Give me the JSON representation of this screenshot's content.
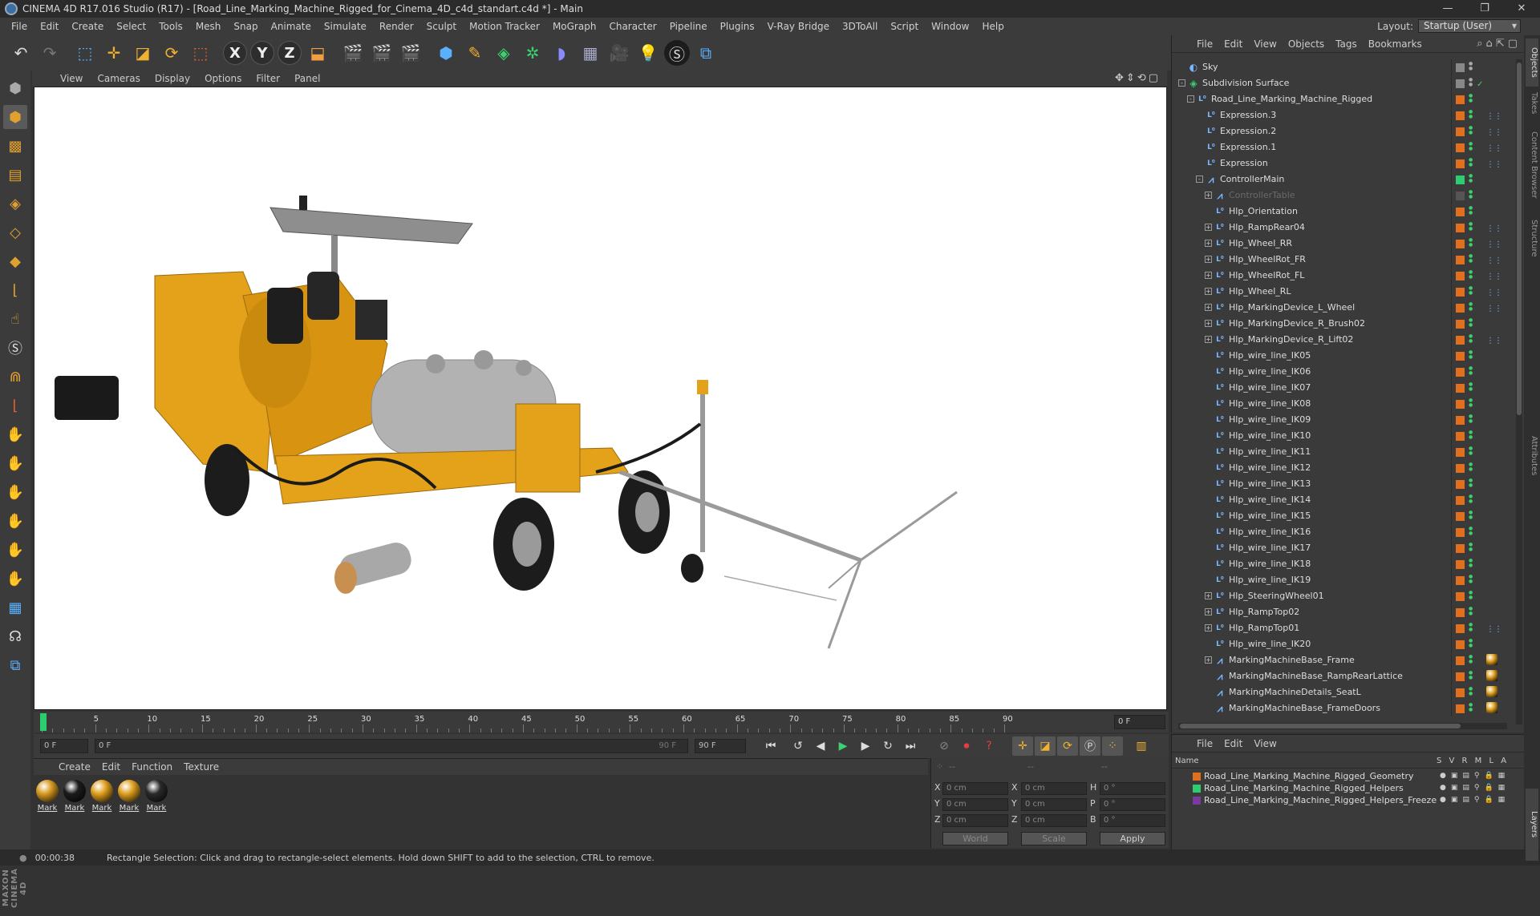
{
  "window": {
    "title": "CINEMA 4D R17.016 Studio (R17) - [Road_Line_Marking_Machine_Rigged_for_Cinema_4D_c4d_standart.c4d *] - Main",
    "layout_label": "Layout:",
    "layout_value": "Startup (User)"
  },
  "menu": [
    "File",
    "Edit",
    "Create",
    "Select",
    "Tools",
    "Mesh",
    "Snap",
    "Animate",
    "Simulate",
    "Render",
    "Sculpt",
    "Motion Tracker",
    "MoGraph",
    "Character",
    "Pipeline",
    "Plugins",
    "V-Ray Bridge",
    "3DToAll",
    "Script",
    "Window",
    "Help"
  ],
  "toolbar": {
    "x": "X",
    "y": "Y",
    "z": "Z"
  },
  "viewport_menu": [
    "View",
    "Cameras",
    "Display",
    "Options",
    "Filter",
    "Panel"
  ],
  "timeline": {
    "ticks": [
      "0",
      "5",
      "10",
      "15",
      "20",
      "25",
      "30",
      "35",
      "40",
      "45",
      "50",
      "55",
      "60",
      "65",
      "70",
      "75",
      "80",
      "85",
      "90"
    ],
    "current_field": "0 F"
  },
  "playback": {
    "start": "0 F",
    "range_start": "0 F",
    "range_end": "90 F",
    "end": "90 F"
  },
  "material_menu": [
    "Create",
    "Edit",
    "Function",
    "Texture"
  ],
  "materials": [
    {
      "label": "Mark",
      "color": "#d89a20"
    },
    {
      "label": "Mark",
      "color": "#1c1c1c"
    },
    {
      "label": "Mark",
      "color": "#e0a020"
    },
    {
      "label": "Mark",
      "color": "#e0a020"
    },
    {
      "label": "Mark",
      "color": "#2a2a2a"
    }
  ],
  "coords": {
    "header": [
      "--",
      "--",
      "--"
    ],
    "x": "X",
    "y": "Y",
    "z": "Z",
    "h": "H",
    "p": "P",
    "b": "B",
    "x_pos": "0 cm",
    "y_pos": "0 cm",
    "z_pos": "0 cm",
    "x_size": "0 cm",
    "y_size": "0 cm",
    "z_size": "0 cm",
    "h_val": "0 °",
    "p_val": "0 °",
    "b_val": "0 °",
    "world": "World",
    "scale": "Scale",
    "apply": "Apply"
  },
  "status": {
    "time": "00:00:38",
    "message": "Rectangle Selection: Click and drag to rectangle-select elements. Hold down SHIFT to add to the selection, CTRL to remove."
  },
  "object_menu": [
    "File",
    "Edit",
    "View",
    "Objects",
    "Tags",
    "Bookmarks"
  ],
  "objects": [
    {
      "name": "Sky",
      "indent": 0,
      "icon": "sky",
      "tag": "#888",
      "ex": ""
    },
    {
      "name": "Subdivision Surface",
      "indent": 0,
      "icon": "sub",
      "tag": "#888",
      "ex": "-",
      "check": "✓"
    },
    {
      "name": "Road_Line_Marking_Machine_Rigged",
      "indent": 1,
      "icon": "null",
      "tag": "#e07020",
      "ex": "-"
    },
    {
      "name": "Expression.3",
      "indent": 2,
      "icon": "null",
      "tag": "#e07020",
      "ex": "",
      "xp": "⋮⋮"
    },
    {
      "name": "Expression.2",
      "indent": 2,
      "icon": "null",
      "tag": "#e07020",
      "ex": "",
      "xp": "⋮⋮"
    },
    {
      "name": "Expression.1",
      "indent": 2,
      "icon": "null",
      "tag": "#e07020",
      "ex": "",
      "xp": "⋮⋮"
    },
    {
      "name": "Expression",
      "indent": 2,
      "icon": "null",
      "tag": "#e07020",
      "ex": "",
      "xp": "⋮⋮"
    },
    {
      "name": "ControllerMain",
      "indent": 2,
      "icon": "joint",
      "tag": "#2ecc71",
      "ex": "-"
    },
    {
      "name": "ControllerTable",
      "indent": 3,
      "icon": "joint",
      "tag": "#555",
      "ex": "+",
      "dim": true
    },
    {
      "name": "Hlp_Orientation",
      "indent": 3,
      "icon": "null",
      "tag": "#e07020",
      "ex": ""
    },
    {
      "name": "Hlp_RampRear04",
      "indent": 3,
      "icon": "null",
      "tag": "#e07020",
      "ex": "+",
      "xp": "⋮⋮"
    },
    {
      "name": "Hlp_Wheel_RR",
      "indent": 3,
      "icon": "null",
      "tag": "#e07020",
      "ex": "+",
      "xp": "⋮⋮"
    },
    {
      "name": "Hlp_WheelRot_FR",
      "indent": 3,
      "icon": "null",
      "tag": "#e07020",
      "ex": "+",
      "xp": "⋮⋮"
    },
    {
      "name": "Hlp_WheelRot_FL",
      "indent": 3,
      "icon": "null",
      "tag": "#e07020",
      "ex": "+",
      "xp": "⋮⋮"
    },
    {
      "name": "Hlp_Wheel_RL",
      "indent": 3,
      "icon": "null",
      "tag": "#e07020",
      "ex": "+",
      "xp": "⋮⋮"
    },
    {
      "name": "Hlp_MarkingDevice_L_Wheel",
      "indent": 3,
      "icon": "null",
      "tag": "#e07020",
      "ex": "+",
      "xp": "⋮⋮"
    },
    {
      "name": "Hlp_MarkingDevice_R_Brush02",
      "indent": 3,
      "icon": "null",
      "tag": "#e07020",
      "ex": "+"
    },
    {
      "name": "Hlp_MarkingDevice_R_Lift02",
      "indent": 3,
      "icon": "null",
      "tag": "#e07020",
      "ex": "+",
      "xp": "⋮⋮"
    },
    {
      "name": "Hlp_wire_line_IK05",
      "indent": 3,
      "icon": "null",
      "tag": "#e07020",
      "ex": ""
    },
    {
      "name": "Hlp_wire_line_IK06",
      "indent": 3,
      "icon": "null",
      "tag": "#e07020",
      "ex": ""
    },
    {
      "name": "Hlp_wire_line_IK07",
      "indent": 3,
      "icon": "null",
      "tag": "#e07020",
      "ex": ""
    },
    {
      "name": "Hlp_wire_line_IK08",
      "indent": 3,
      "icon": "null",
      "tag": "#e07020",
      "ex": ""
    },
    {
      "name": "Hlp_wire_line_IK09",
      "indent": 3,
      "icon": "null",
      "tag": "#e07020",
      "ex": ""
    },
    {
      "name": "Hlp_wire_line_IK10",
      "indent": 3,
      "icon": "null",
      "tag": "#e07020",
      "ex": ""
    },
    {
      "name": "Hlp_wire_line_IK11",
      "indent": 3,
      "icon": "null",
      "tag": "#e07020",
      "ex": ""
    },
    {
      "name": "Hlp_wire_line_IK12",
      "indent": 3,
      "icon": "null",
      "tag": "#e07020",
      "ex": ""
    },
    {
      "name": "Hlp_wire_line_IK13",
      "indent": 3,
      "icon": "null",
      "tag": "#e07020",
      "ex": ""
    },
    {
      "name": "Hlp_wire_line_IK14",
      "indent": 3,
      "icon": "null",
      "tag": "#e07020",
      "ex": ""
    },
    {
      "name": "Hlp_wire_line_IK15",
      "indent": 3,
      "icon": "null",
      "tag": "#e07020",
      "ex": ""
    },
    {
      "name": "Hlp_wire_line_IK16",
      "indent": 3,
      "icon": "null",
      "tag": "#e07020",
      "ex": ""
    },
    {
      "name": "Hlp_wire_line_IK17",
      "indent": 3,
      "icon": "null",
      "tag": "#e07020",
      "ex": ""
    },
    {
      "name": "Hlp_wire_line_IK18",
      "indent": 3,
      "icon": "null",
      "tag": "#e07020",
      "ex": ""
    },
    {
      "name": "Hlp_wire_line_IK19",
      "indent": 3,
      "icon": "null",
      "tag": "#e07020",
      "ex": ""
    },
    {
      "name": "Hlp_SteeringWheel01",
      "indent": 3,
      "icon": "null",
      "tag": "#e07020",
      "ex": "+"
    },
    {
      "name": "Hlp_RampTop02",
      "indent": 3,
      "icon": "null",
      "tag": "#e07020",
      "ex": "+"
    },
    {
      "name": "Hlp_RampTop01",
      "indent": 3,
      "icon": "null",
      "tag": "#e07020",
      "ex": "+",
      "xp": "⋮⋮"
    },
    {
      "name": "Hlp_wire_line_IK20",
      "indent": 3,
      "icon": "null",
      "tag": "#e07020",
      "ex": ""
    },
    {
      "name": "MarkingMachineBase_Frame",
      "indent": 3,
      "icon": "joint",
      "tag": "#e07020",
      "ex": "+",
      "mat": true
    },
    {
      "name": "MarkingMachineBase_RampRearLattice",
      "indent": 3,
      "icon": "joint",
      "tag": "#e07020",
      "ex": "",
      "mat": true
    },
    {
      "name": "MarkingMachineDetails_SeatL",
      "indent": 3,
      "icon": "joint",
      "tag": "#e07020",
      "ex": "",
      "mat": true
    },
    {
      "name": "MarkingMachineBase_FrameDoors",
      "indent": 3,
      "icon": "joint",
      "tag": "#e07020",
      "ex": "",
      "mat": true
    }
  ],
  "layer_menu": [
    "File",
    "Edit",
    "View"
  ],
  "layer_header": {
    "name": "Name",
    "cols": "S V R M L A"
  },
  "layers": [
    {
      "name": "Road_Line_Marking_Machine_Rigged_Geometry",
      "color": "#e07020"
    },
    {
      "name": "Road_Line_Marking_Machine_Rigged_Helpers",
      "color": "#2ecc71"
    },
    {
      "name": "Road_Line_Marking_Machine_Rigged_Helpers_Freeze",
      "color": "#7a3aa0"
    }
  ],
  "right_tabs": [
    "Objects",
    "Takes",
    "Content Browser",
    "Structure",
    "Attributes",
    "Layers"
  ]
}
